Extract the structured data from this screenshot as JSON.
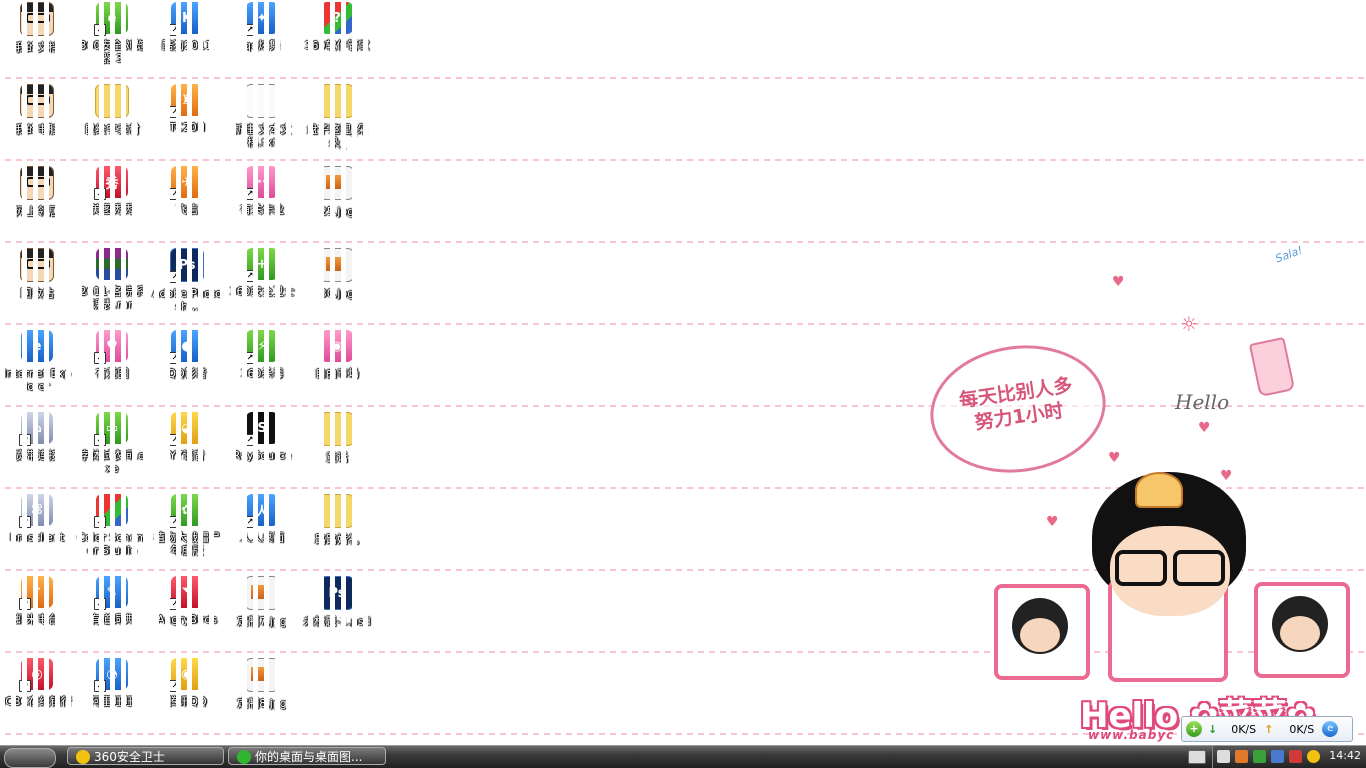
{
  "desktop": {
    "icons": [
      {
        "id": "my-documents",
        "label": "我的文档",
        "style": "face",
        "shortcut": false
      },
      {
        "id": "360-browser",
        "label": "360安全浏览器 3",
        "style": "green",
        "glyph": "e",
        "shortcut": true
      },
      {
        "id": "kuwo-2011",
        "label": "酷狗2011",
        "style": "blue",
        "glyph": "K",
        "shortcut": true
      },
      {
        "id": "qq-dance",
        "label": "qq炫舞",
        "style": "blue",
        "glyph": "✦",
        "shortcut": true
      },
      {
        "id": "360-software-manager",
        "label": "360软件管家",
        "style": "multi",
        "glyph": "?",
        "shortcut": false
      },
      {
        "id": "my-computer",
        "label": "我的电脑",
        "style": "face",
        "shortcut": false
      },
      {
        "id": "folder-drawing",
        "label": "鼠绘字素材",
        "style": "folder",
        "shortcut": false
      },
      {
        "id": "tc20h",
        "label": "TC20H",
        "style": "orange",
        "glyph": "♜",
        "shortcut": true
      },
      {
        "id": "new-text-doc",
        "label": "新建 文本文档.txt",
        "style": "doc",
        "shortcut": false
      },
      {
        "id": "folder-duoduo",
        "label": "盘子整理_朵朵_",
        "style": "folder",
        "shortcut": false
      },
      {
        "id": "network-neighborhood",
        "label": "网上邻居",
        "style": "face",
        "shortcut": false
      },
      {
        "id": "meitu",
        "label": "美图秀秀",
        "style": "red",
        "glyph": "秀",
        "shortcut": true
      },
      {
        "id": "fetion",
        "label": "飞信",
        "style": "orange",
        "glyph": "✈",
        "shortcut": true
      },
      {
        "id": "homework",
        "label": "有关作业",
        "style": "pink",
        "glyph": "··",
        "shortcut": true
      },
      {
        "id": "img-25",
        "label": "25.jpg",
        "style": "jpg",
        "shortcut": false
      },
      {
        "id": "recycle-bin",
        "label": "回收站",
        "style": "face",
        "shortcut": false
      },
      {
        "id": "rar-schedule",
        "label": "2011-各院系课表.rar",
        "style": "winrar",
        "shortcut": false
      },
      {
        "id": "photoshop",
        "label": "Adobe Photosh...",
        "style": "ps",
        "glyph": "Ps",
        "shortcut": true
      },
      {
        "id": "360-safe",
        "label": "360安全卫士",
        "style": "green",
        "glyph": "+",
        "shortcut": true
      },
      {
        "id": "img-30",
        "label": "30.jpg",
        "style": "jpg",
        "shortcut": false
      },
      {
        "id": "internet-explorer",
        "label": "Internet Explorer",
        "style": "blue",
        "glyph": "e",
        "shortcut": false
      },
      {
        "id": "youai-tu",
        "label": "有爱图",
        "style": "pink",
        "glyph": "♥",
        "shortcut": true
      },
      {
        "id": "qq-player",
        "label": "QQ影音",
        "style": "blue",
        "glyph": "●",
        "shortcut": true
      },
      {
        "id": "360-antivirus",
        "label": "360杀毒",
        "style": "green",
        "glyph": "⚡",
        "shortcut": true
      },
      {
        "id": "free-market",
        "label": "自由市场",
        "style": "pink",
        "glyph": "◉",
        "shortcut": false
      },
      {
        "id": "broadband",
        "label": "宽带连接",
        "style": "gray",
        "glyph": "⌂",
        "shortcut": true
      },
      {
        "id": "font-tester",
        "label": "字体试衣间.exe",
        "style": "green",
        "glyph": "▭",
        "shortcut": true
      },
      {
        "id": "yy-voice",
        "label": "YY语音",
        "style": "yellowface",
        "glyph": "◕",
        "shortcut": true
      },
      {
        "id": "raysource",
        "label": "RaySource",
        "style": "black",
        "glyph": "S",
        "shortcut": true
      },
      {
        "id": "folder-tongzhi",
        "label": "童话",
        "style": "folder",
        "shortcut": false
      },
      {
        "id": "brasclient",
        "label": "brasclient",
        "style": "gray",
        "glyph": "⌘",
        "shortcut": true
      },
      {
        "id": "color-schemer",
        "label": "Color Schemer Studio",
        "style": "multi",
        "glyph": "",
        "shortcut": true
      },
      {
        "id": "plants-zombies",
        "label": "植物大战僵尸年度版",
        "style": "green",
        "glyph": "✿",
        "shortcut": true
      },
      {
        "id": "renren-desktop",
        "label": "人人桌面",
        "style": "blue",
        "glyph": "人",
        "shortcut": true
      },
      {
        "id": "folder-wedding",
        "label": "路路婚礼",
        "style": "folder",
        "shortcut": false
      },
      {
        "id": "xiami-radio",
        "label": "虾米电台",
        "style": "orange",
        "glyph": "♪",
        "shortcut": true
      },
      {
        "id": "youdao-dict",
        "label": "有道词典",
        "style": "blue",
        "glyph": "✎",
        "shortcut": true
      },
      {
        "id": "angry-birds",
        "label": "AngryBirds",
        "style": "red",
        "glyph": "◥",
        "shortcut": true
      },
      {
        "id": "img-dingzhi7",
        "label": "定制7.jpg",
        "style": "jpg",
        "shortcut": false
      },
      {
        "id": "untitled-psd",
        "label": "未标题-1.psd",
        "style": "ps",
        "glyph": "Ps",
        "shortcut": false
      },
      {
        "id": "icbc-bank",
        "label": "ICBC在线银行",
        "style": "red",
        "glyph": "◎",
        "shortcut": true
      },
      {
        "id": "aliwangwang",
        "label": "阿里旺旺",
        "style": "blue",
        "glyph": "◔",
        "shortcut": true
      },
      {
        "id": "tencent-qq",
        "label": "腾讯QQ",
        "style": "yellowface",
        "glyph": "◉",
        "shortcut": true
      },
      {
        "id": "img-dingzhi8",
        "label": "定制8.jpg",
        "style": "jpg",
        "shortcut": false
      }
    ]
  },
  "wallpaper": {
    "bubble_text": "每天比别人多努力1小时",
    "hello_script": "Hello",
    "logo_text": "Hello ✿菜菜✿",
    "web_text": "www.babyc",
    "sala_text": "Sala!"
  },
  "netwidget": {
    "down_speed": "0K/S",
    "up_speed": "0K/S"
  },
  "taskbar": {
    "tasks": [
      {
        "label": "360安全卫士",
        "color": "#f2c20f"
      },
      {
        "label": "你的桌面与桌面图...",
        "color": "#2fb52f"
      }
    ],
    "clock": "14:42"
  },
  "colors": {
    "accent_pink": "#ea6a92",
    "taskbar_dark": "#202020"
  }
}
